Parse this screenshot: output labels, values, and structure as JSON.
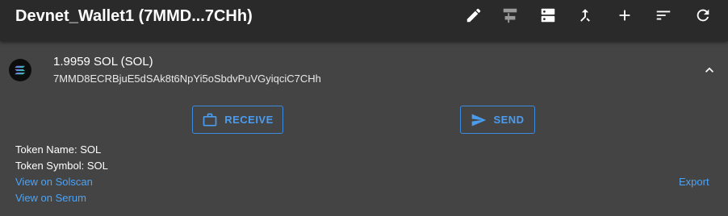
{
  "header": {
    "title": "Devnet_Wallet1 (7MMD...7CHh)",
    "icons": [
      "edit-icon",
      "merge-accounts-icon",
      "dns-icon",
      "call-merge-icon",
      "add-icon",
      "sort-icon",
      "refresh-icon"
    ]
  },
  "account": {
    "balance": "1.9959 SOL (SOL)",
    "address": "7MMD8ECRBjuE5dSAk8t6NpYi5oSbdvPuVGyiqciC7CHh"
  },
  "actions": {
    "receive_label": "RECEIVE",
    "send_label": "SEND"
  },
  "details": {
    "token_name": "Token Name: SOL",
    "token_symbol": "Token Symbol: SOL",
    "solscan_link": "View on Solscan",
    "serum_link": "View on Serum",
    "export_link": "Export"
  },
  "colors": {
    "header_bg": "#2a2a2a",
    "body_bg": "#444444",
    "accent": "#4a9cf0"
  }
}
